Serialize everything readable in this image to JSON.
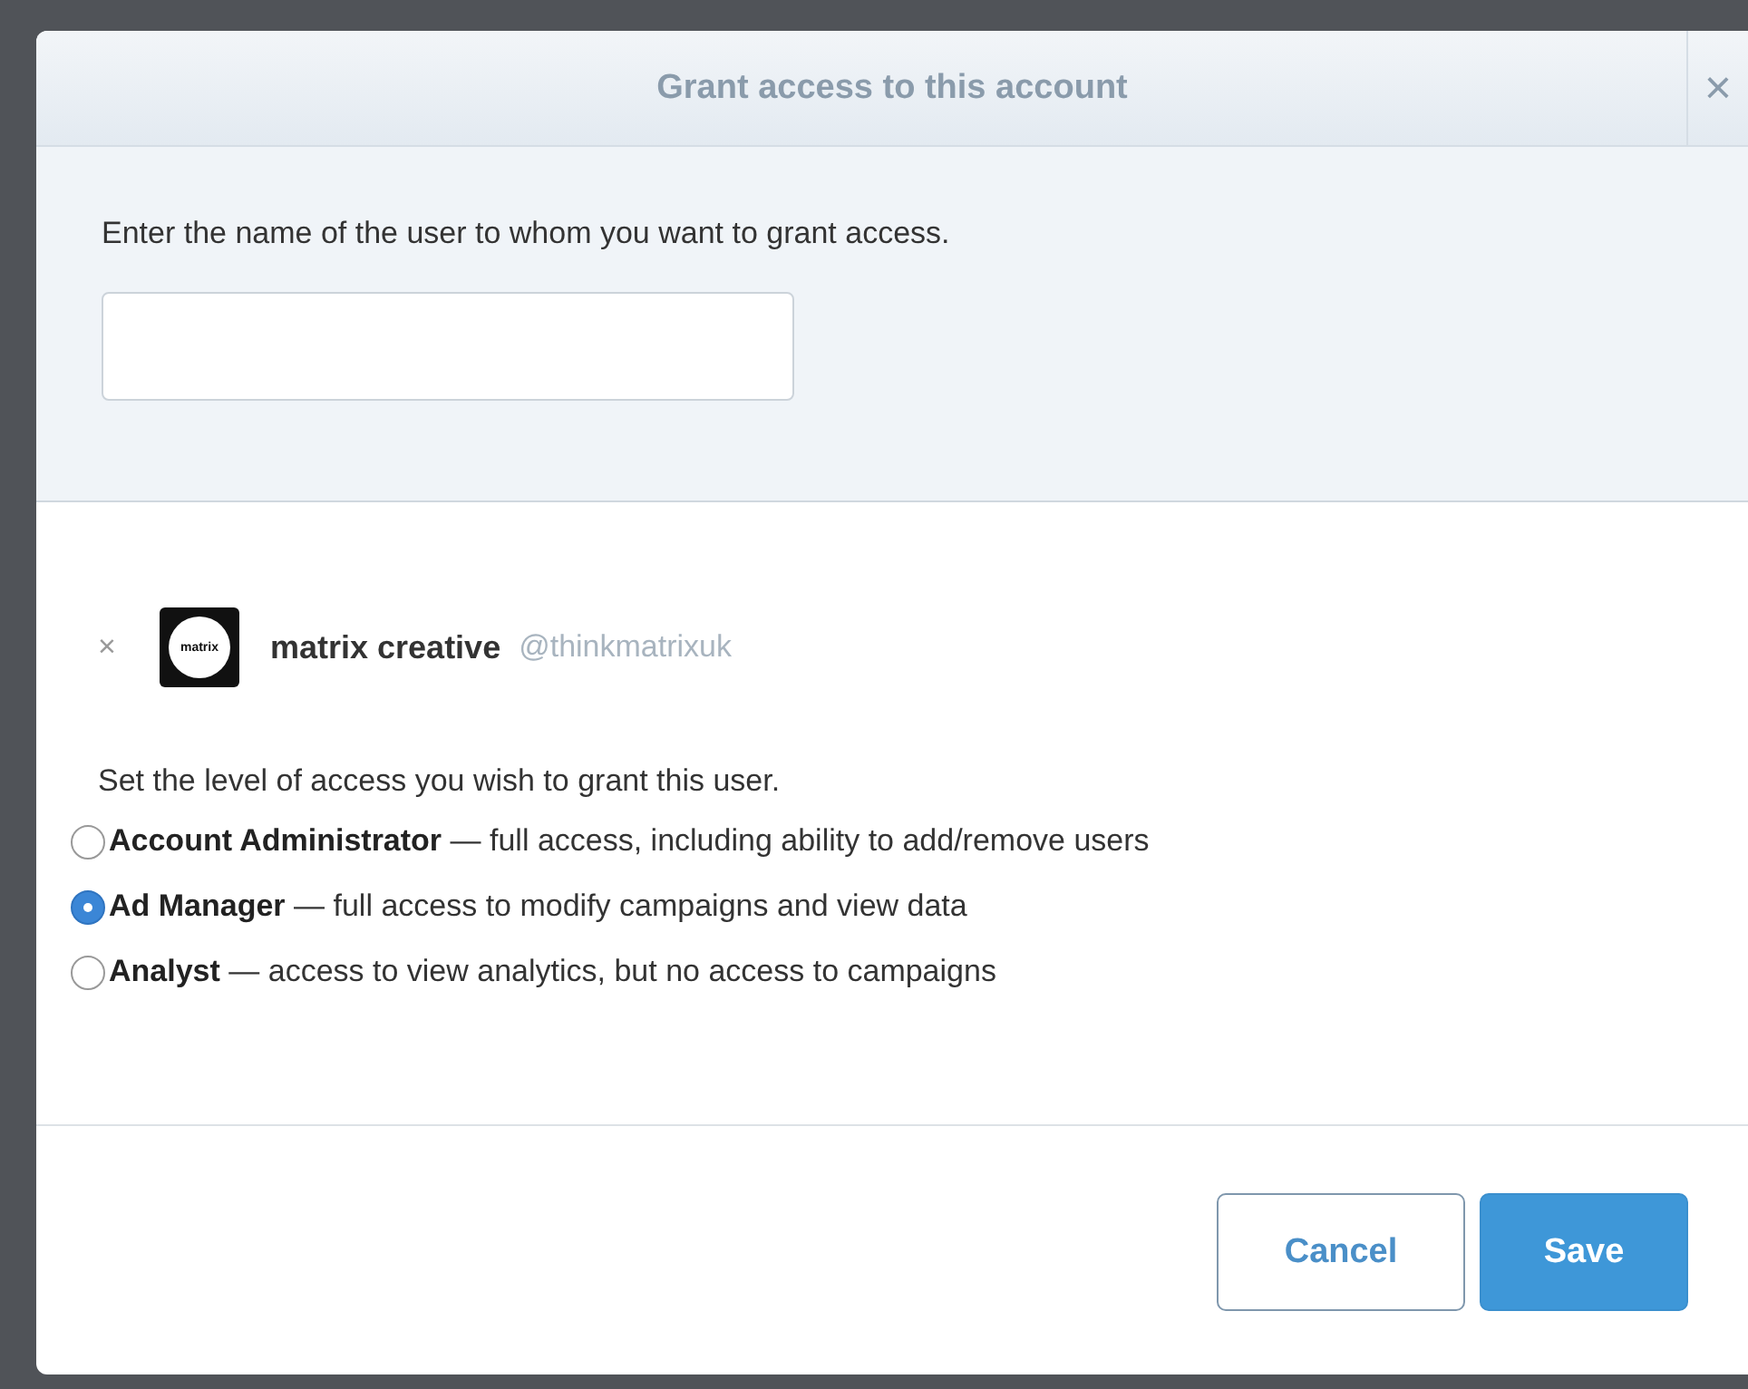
{
  "dialog": {
    "title": "Grant access to this account",
    "close": "×"
  },
  "prompt": "Enter the name of the user to whom you want to grant access.",
  "user": {
    "remove": "×",
    "logo_text": "matrix",
    "name": "matrix creative",
    "handle": "@thinkmatrixuk"
  },
  "level_prompt": "Set the level of access you wish to grant this user.",
  "roles": [
    {
      "name": "Account Administrator",
      "description": "— full access, including ability to add/remove users",
      "selected": false
    },
    {
      "name": "Ad Manager",
      "description": "— full access to modify campaigns and view data",
      "selected": true
    },
    {
      "name": "Analyst",
      "description": "— access to view analytics, but no access to campaigns",
      "selected": false
    }
  ],
  "buttons": [
    {
      "label": "Cancel",
      "kind": "secondary"
    },
    {
      "label": "Save",
      "kind": "primary"
    }
  ]
}
